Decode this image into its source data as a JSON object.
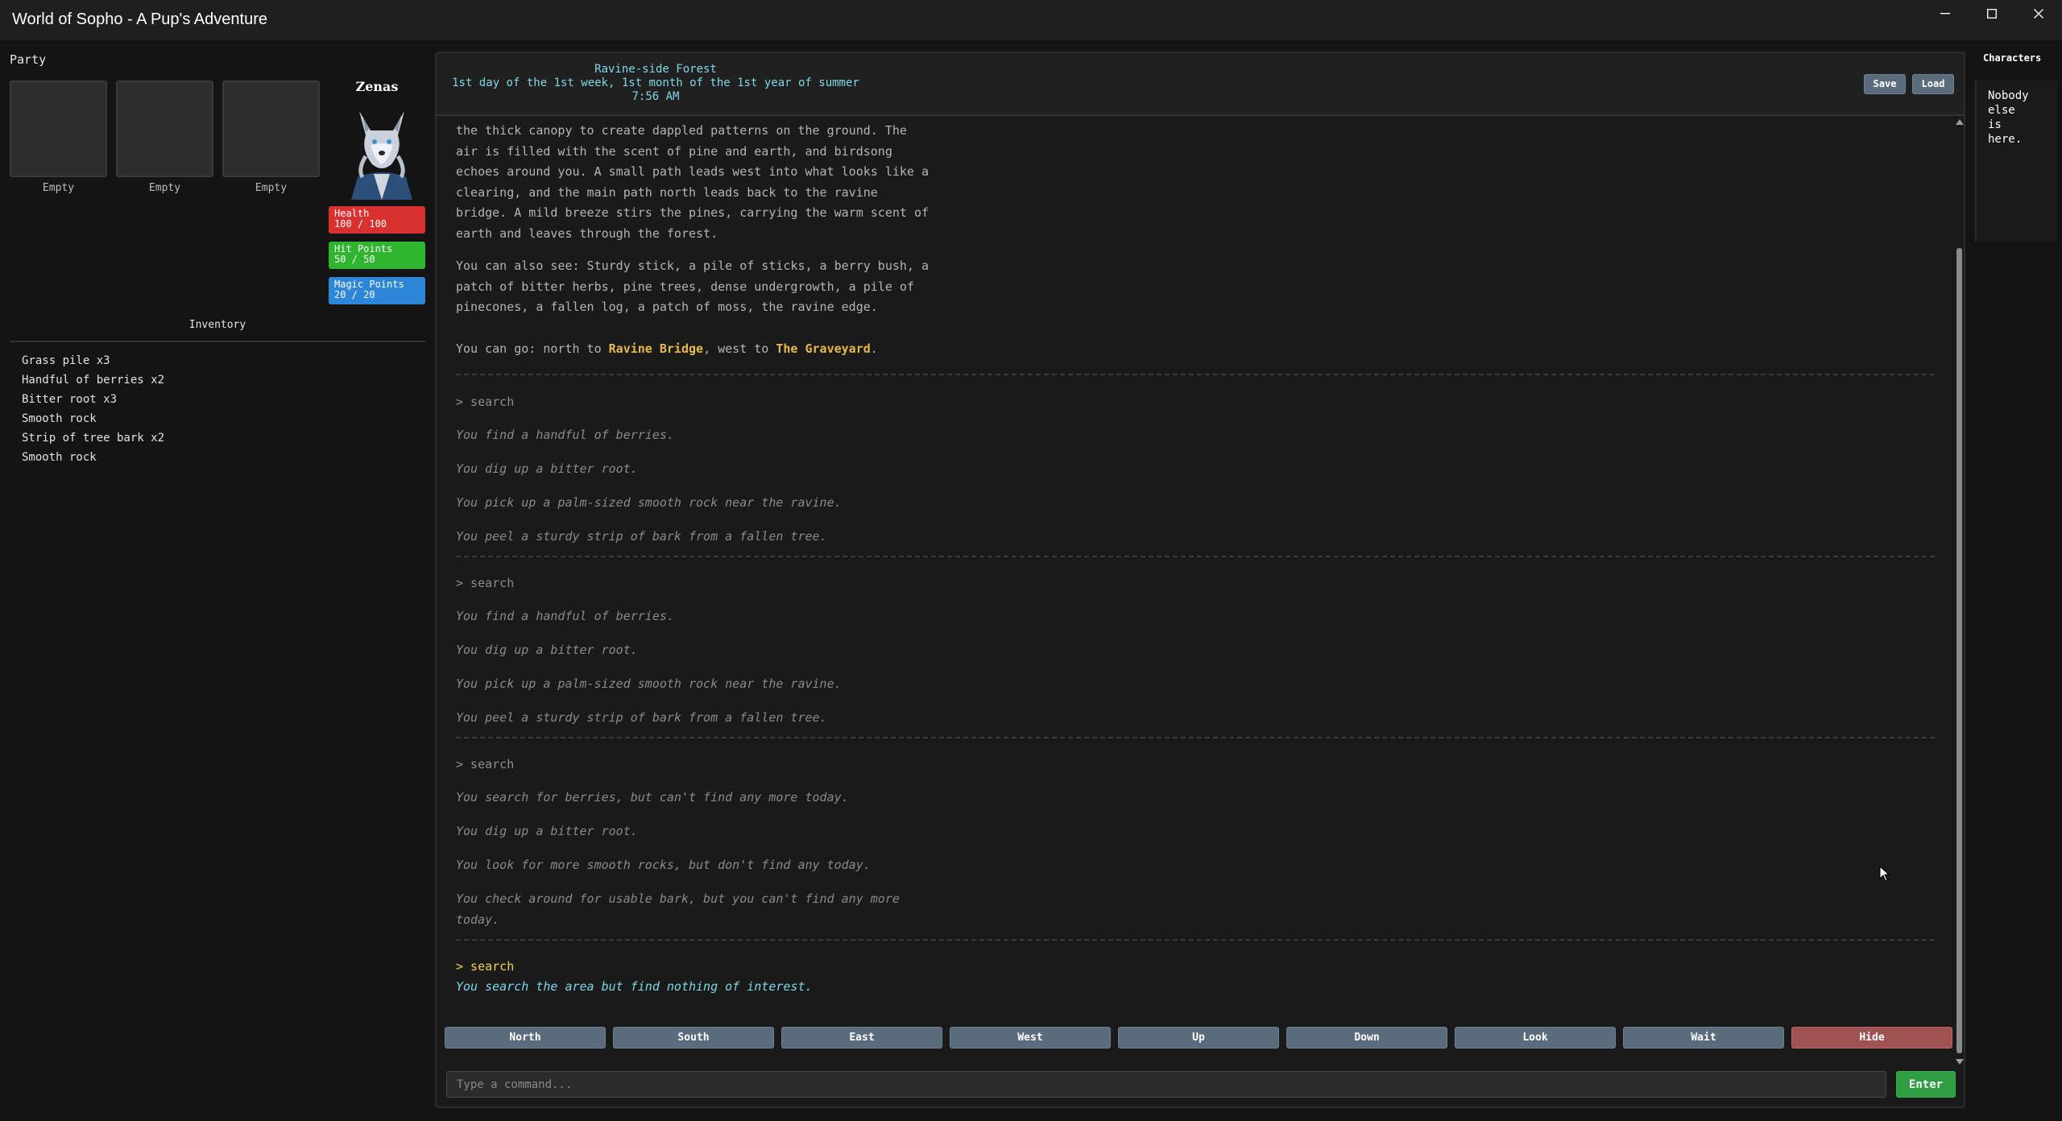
{
  "window": {
    "title": "World of Sopho - A Pup's Adventure",
    "controls": {
      "minimize_icon": "minimize-icon",
      "maximize_icon": "maximize-icon",
      "close_icon": "close-icon"
    }
  },
  "party": {
    "label": "Party",
    "slots": [
      {
        "label": "Empty"
      },
      {
        "label": "Empty"
      },
      {
        "label": "Empty"
      }
    ],
    "character": {
      "name": "Zenas",
      "stats": {
        "health": {
          "label": "Health",
          "value": "100 / 100",
          "color": "#d93030",
          "fraction": 1.0
        },
        "hit_points": {
          "label": "Hit Points",
          "value": "50 / 50",
          "color": "#2fb52f",
          "fraction": 1.0
        },
        "magic_points": {
          "label": "Magic Points",
          "value": "20 / 20",
          "color": "#2d86d8",
          "fraction": 1.0
        }
      }
    }
  },
  "inventory": {
    "title": "Inventory",
    "items": [
      "Grass pile x3",
      "Handful of berries x2",
      "Bitter root x3",
      "Smooth rock",
      "Strip of tree bark x2",
      "Smooth rock"
    ]
  },
  "location": {
    "name": "Ravine-side Forest",
    "date": "1st day of the 1st week, 1st month of the 1st year of summer",
    "time": "7:56 AM"
  },
  "header_buttons": {
    "save": "Save",
    "load": "Load"
  },
  "log": {
    "description_lines": [
      "the thick canopy to create dappled patterns on the ground. The",
      "air is filled with the scent of pine and earth, and birdsong",
      "echoes around you. A small path leads west into what looks like a",
      "clearing, and the main path north leads back to the ravine",
      "bridge. A mild breeze stirs the pines, carrying the warm scent of",
      "earth and leaves through the forest."
    ],
    "see_lines": [
      "You can also see: Sturdy stick, a pile of sticks, a berry bush, a",
      "patch of bitter herbs, pine trees, dense undergrowth, a pile of",
      "pinecones, a fallen log, a patch of moss, the ravine edge."
    ],
    "exits": {
      "prefix": "You can go: north to ",
      "north_link": "Ravine Bridge",
      "middle": ", west to ",
      "west_link": "The Graveyard",
      "suffix": "."
    },
    "entries": [
      {
        "command": "> search",
        "results": [
          "You find a handful of berries.",
          "You dig up a bitter root.",
          "You pick up a palm-sized smooth rock near the ravine.",
          "You peel a sturdy strip of bark from a fallen tree."
        ]
      },
      {
        "command": "> search",
        "results": [
          "You find a handful of berries.",
          "You dig up a bitter root.",
          "You pick up a palm-sized smooth rock near the ravine.",
          "You peel a sturdy strip of bark from a fallen tree."
        ]
      },
      {
        "command": "> search",
        "results": [
          "You search for berries, but can't find any more today.",
          "You dig up a bitter root.",
          "You look for more smooth rocks, but don't find any today.",
          "You check around for usable bark, but you can't find any more\ntoday."
        ]
      }
    ],
    "last_command": "> search",
    "last_result": "You search the area but find nothing of interest."
  },
  "directions": [
    "North",
    "South",
    "East",
    "West",
    "Up",
    "Down",
    "Look",
    "Wait",
    "Hide"
  ],
  "command_input": {
    "placeholder": "Type a command...",
    "value": ""
  },
  "enter_button": "Enter",
  "characters_panel": {
    "title": "Characters",
    "text": "Nobody\nelse\nis\nhere."
  },
  "colors": {
    "background": "#141414",
    "panel": "#1a1a1a",
    "button": "#5a6c7c",
    "hide_button": "#a05252",
    "enter_button": "#2f9e43",
    "location_text": "#7fd8e8",
    "link_text": "#e7b84a",
    "last_command": "#f2d04a"
  }
}
